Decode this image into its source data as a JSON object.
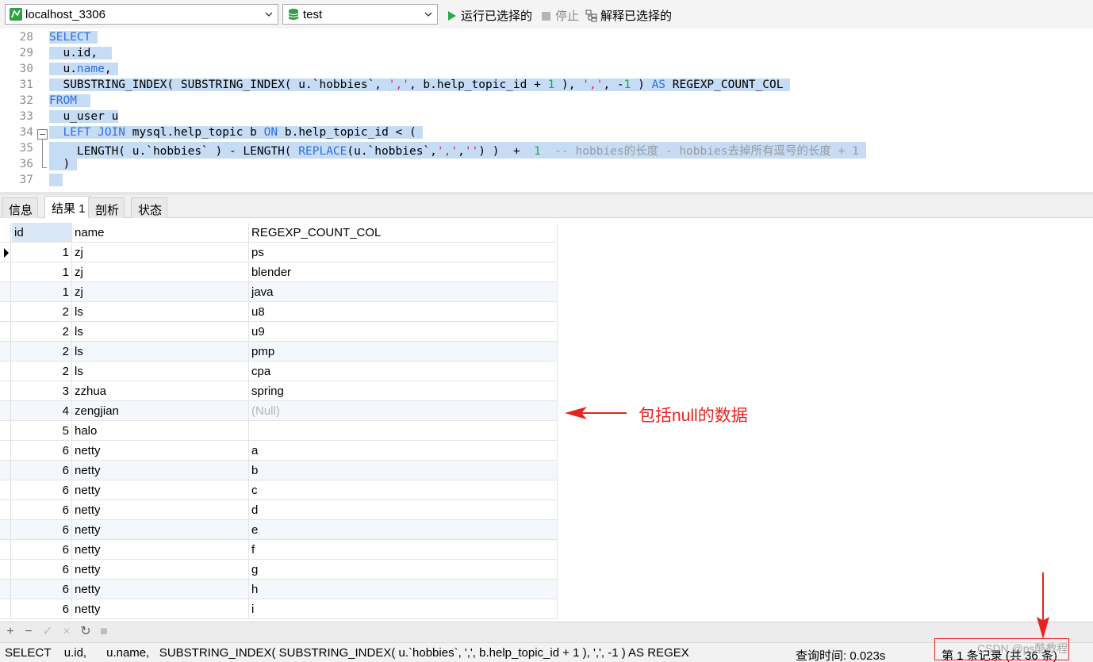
{
  "toolbar": {
    "connection": "localhost_3306",
    "database": "test",
    "run_selected": "运行已选择的",
    "stop": "停止",
    "explain_selected": "解释已选择的"
  },
  "editor": {
    "lines": [
      {
        "n": "28"
      },
      {
        "n": "29"
      },
      {
        "n": "30"
      },
      {
        "n": "31"
      },
      {
        "n": "32"
      },
      {
        "n": "33"
      },
      {
        "n": "34"
      },
      {
        "n": "35"
      },
      {
        "n": "36"
      },
      {
        "n": "37"
      }
    ]
  },
  "tabs": [
    "信息",
    "结果 1",
    "剖析",
    "状态"
  ],
  "grid": {
    "columns": [
      "id",
      "name",
      "REGEXP_COUNT_COL"
    ],
    "rows": [
      [
        "1",
        "zj",
        "ps"
      ],
      [
        "1",
        "zj",
        "blender"
      ],
      [
        "1",
        "zj",
        "java"
      ],
      [
        "2",
        "ls",
        "u8"
      ],
      [
        "2",
        "ls",
        "u9"
      ],
      [
        "2",
        "ls",
        "pmp"
      ],
      [
        "2",
        "ls",
        "cpa"
      ],
      [
        "3",
        "zzhua",
        "spring"
      ],
      [
        "4",
        "zengjian",
        "(Null)"
      ],
      [
        "5",
        "halo",
        ""
      ],
      [
        "6",
        "netty",
        "a"
      ],
      [
        "6",
        "netty",
        "b"
      ],
      [
        "6",
        "netty",
        "c"
      ],
      [
        "6",
        "netty",
        "d"
      ],
      [
        "6",
        "netty",
        "e"
      ],
      [
        "6",
        "netty",
        "f"
      ],
      [
        "6",
        "netty",
        "g"
      ],
      [
        "6",
        "netty",
        "h"
      ],
      [
        "6",
        "netty",
        "i"
      ]
    ]
  },
  "annotation": {
    "text": "包括null的数据",
    "color": "#e8231f"
  },
  "gridbar": {
    "icons": [
      "plus-icon",
      "minus-icon",
      "check-icon",
      "cross-icon",
      "refresh-icon",
      "stop-icon"
    ]
  },
  "status": {
    "sql": "SELECT    u.id,      u.name,   SUBSTRING_INDEX( SUBSTRING_INDEX( u.`hobbies`, ',', b.help_topic_id + 1 ), ',', -1 ) AS REGEX",
    "query_time": "查询时间: 0.023s",
    "record": "第 1 条记录 (共 36 条)",
    "watermark": "CSDN @ps酷教程"
  },
  "colors": {
    "keyword": "#2f6fe0",
    "string": "#e0245e",
    "number": "#19a45a",
    "comment": "#9a9a9a",
    "selection": "#c6dcf5"
  }
}
